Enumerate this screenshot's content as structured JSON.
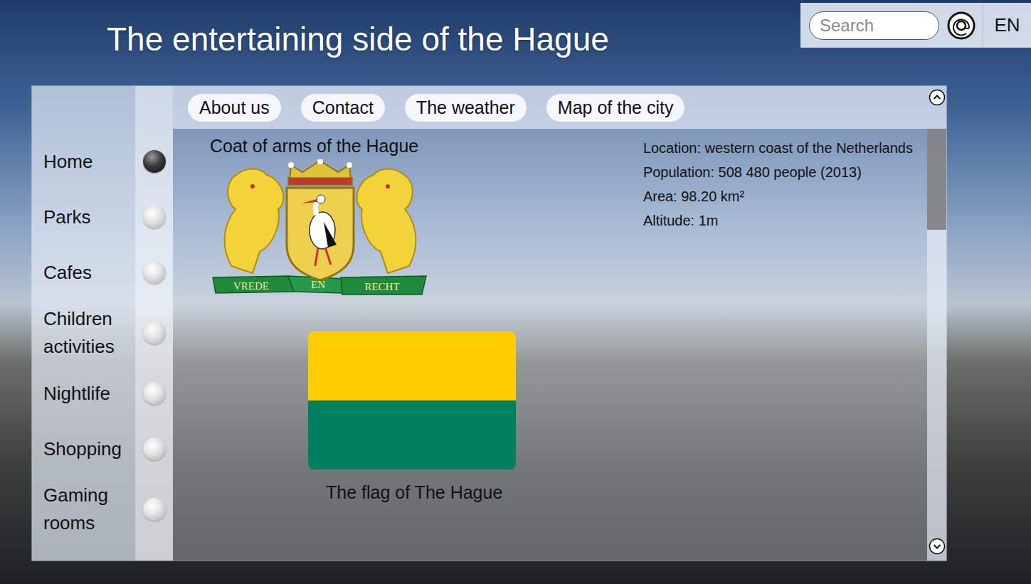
{
  "title": "The entertaining side of the Hague",
  "search": {
    "placeholder": "Search"
  },
  "language": "EN",
  "nav": [
    "About us",
    "Contact",
    "The weather",
    "Map of the city"
  ],
  "sidebar": {
    "items": [
      {
        "label": "Home",
        "selected": true
      },
      {
        "label": "Parks",
        "selected": false
      },
      {
        "label": "Cafes",
        "selected": false
      },
      {
        "label": "Children activities",
        "selected": false
      },
      {
        "label": "Nightlife",
        "selected": false
      },
      {
        "label": "Shopping",
        "selected": false
      },
      {
        "label": "Gaming rooms",
        "selected": false
      }
    ]
  },
  "coat_of_arms": {
    "caption": "Coat of arms of the Hague",
    "motto": [
      "VREDE",
      "EN",
      "RECHT"
    ]
  },
  "flag": {
    "caption": "The flag of The Hague"
  },
  "info": [
    "Location: western coast of the Netherlands",
    "Population: 508 480 people (2013)",
    "Area: 98.20 km²",
    "Altitude: 1m"
  ],
  "scrollbar": {
    "level": 0.25
  }
}
